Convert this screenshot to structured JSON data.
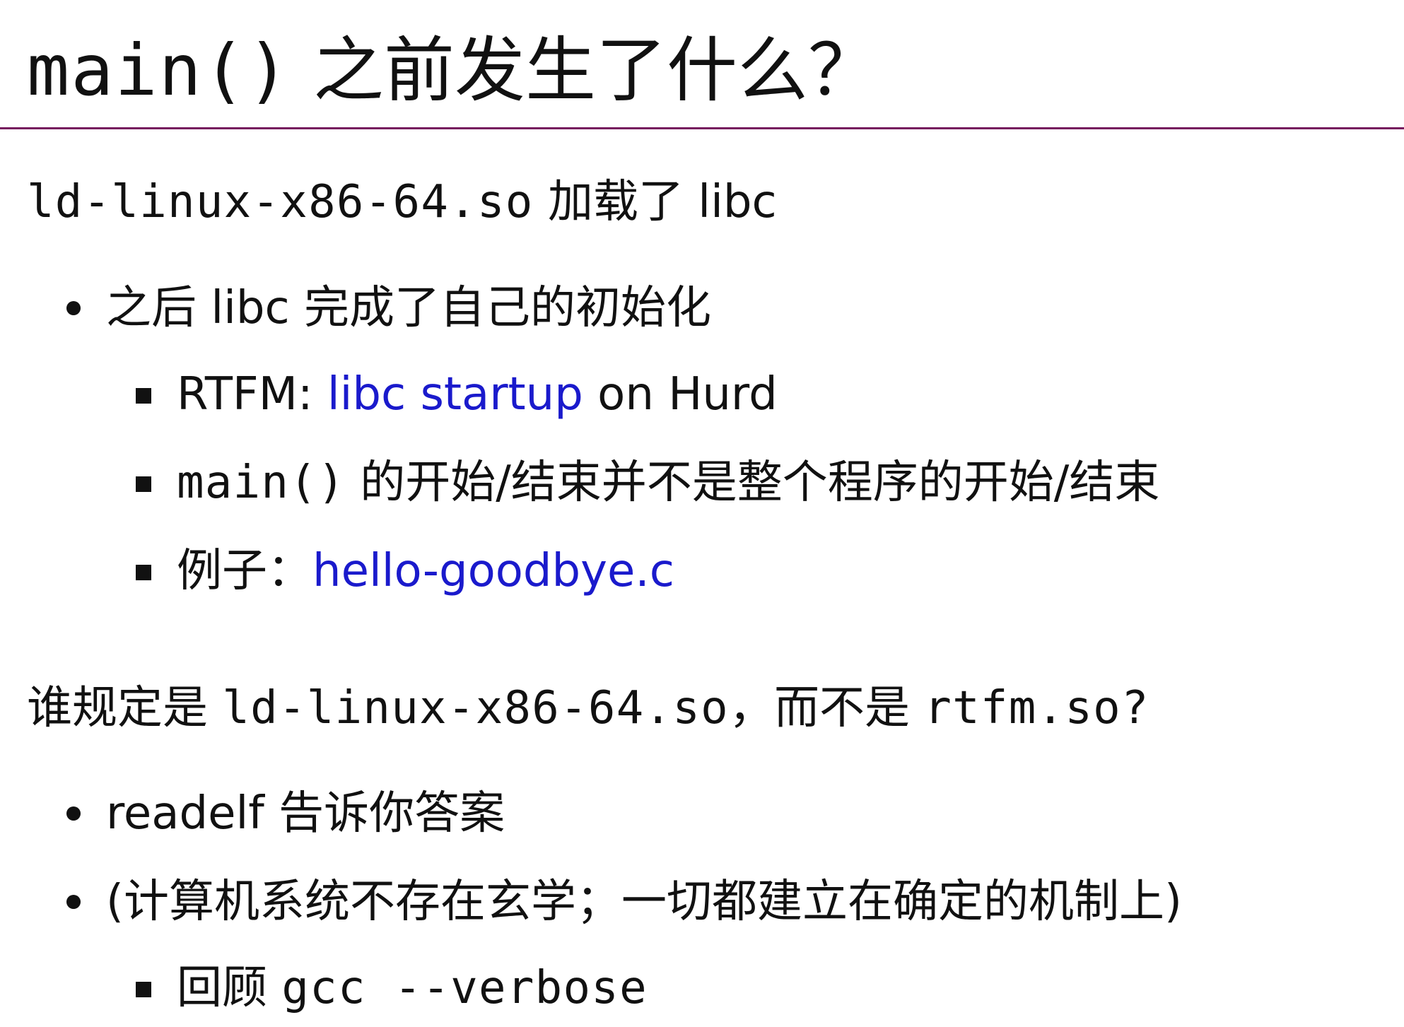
{
  "title": {
    "code": "main()",
    "text": " 之前发生了什么？"
  },
  "section1": {
    "heading": {
      "code": "ld-linux-x86-64.so",
      "text": " 加载了 libc"
    },
    "bullet1": {
      "text": "之后 libc 完成了自己的初始化"
    },
    "sub1": {
      "prefix": "RTFM: ",
      "link": "libc startup",
      "suffix": " on Hurd"
    },
    "sub2": {
      "code": "main()",
      "text": " 的开始/结束并不是整个程序的开始/结束"
    },
    "sub3": {
      "prefix": "例子：",
      "link": "hello-goodbye.c"
    }
  },
  "section2": {
    "heading": {
      "prefix": "谁规定是 ",
      "code1": "ld-linux-x86-64.so",
      "middle": "，而不是 ",
      "code2": "rtfm.so",
      "suffix": "?"
    },
    "bullet1": {
      "text": "readelf 告诉你答案"
    },
    "bullet2": {
      "text": "(计算机系统不存在玄学；一切都建立在确定的机制上)"
    },
    "sub1": {
      "prefix": "回顾 ",
      "code": "gcc --verbose"
    }
  },
  "colors": {
    "rule": "#76195e",
    "link": "#1a1acc",
    "text": "#111111"
  }
}
